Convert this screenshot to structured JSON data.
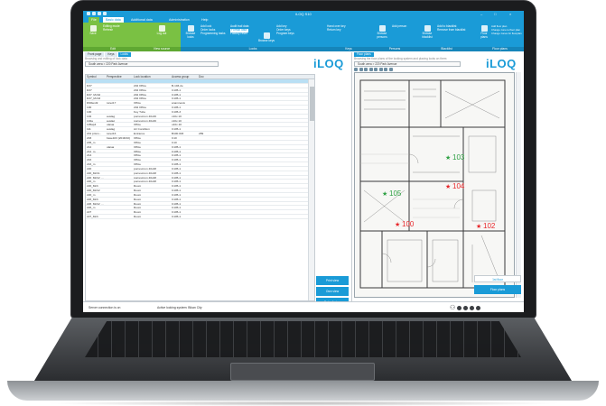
{
  "app": {
    "title": "iLOQ S10",
    "window_controls": [
      "–",
      "□",
      "×"
    ]
  },
  "tabs": [
    {
      "label": "File"
    },
    {
      "label": "Basic data"
    },
    {
      "label": "Additional data"
    },
    {
      "label": "Administration"
    },
    {
      "label": "Help"
    }
  ],
  "ribbon": {
    "groups": [
      {
        "label": "Edit"
      },
      {
        "label": "View source"
      },
      {
        "label": "Locks"
      },
      {
        "label": "Keys"
      },
      {
        "label": "Persons"
      },
      {
        "label": "Blacklist"
      },
      {
        "label": "Floor plans"
      }
    ],
    "edit": {
      "save": "Save",
      "list": [
        "Editing mode",
        "Refresh"
      ]
    },
    "view": {
      "cancel": "Log out"
    },
    "locks": {
      "browse": "Browse locks",
      "list": [
        "Add lock",
        "Order locks",
        "Programming tasks"
      ],
      "list2": [
        "Audit trail data",
        "Format data",
        "Factory reset"
      ]
    },
    "keys": {
      "browse": "Browse keys",
      "list": [
        "Add key",
        "Order keys",
        "Program keys"
      ],
      "list2": [
        "Hand over key",
        "Return key"
      ]
    },
    "persons": {
      "browse": "Browse persons",
      "list": [
        "Add person"
      ]
    },
    "blacklist": {
      "browse": "Browse blacklist",
      "list": [
        "Add to blacklist",
        "Remove from blacklist"
      ]
    },
    "floor": {
      "btn": "Floor plans",
      "list": [
        "Add floor plan",
        "Change zone to floor plan",
        "Change zones for floorplan"
      ]
    }
  },
  "left_panel": {
    "tabs": [
      "Front page",
      "Keys",
      "Locks"
    ],
    "caption": "Browsing and editing of lock data",
    "address": "South area  >  220 Park Avenue",
    "logo": "iLOQ",
    "columns": [
      "Symbol",
      "Perspective",
      "Lock location",
      "Access group",
      "Doc"
    ],
    "rows": [
      [
        "",
        "",
        "",
        "",
        ""
      ],
      [
        "D37",
        "",
        "202 Office",
        "B-103-2e",
        ""
      ],
      [
        "D37",
        "",
        "202 Office",
        "C105-1",
        ""
      ],
      [
        "D37_Mnh2",
        "",
        "202 Office",
        "C105-1",
        ""
      ],
      [
        "D37_Mnh3",
        "",
        "202 Office",
        "C105-1",
        ""
      ],
      [
        "D90test9",
        "tunet17",
        "Office",
        "anamnesis",
        ""
      ],
      [
        "100",
        "",
        "202 Office",
        "C105-1",
        ""
      ],
      [
        "100",
        "",
        "Key Tube",
        "C105-3",
        ""
      ],
      [
        "102",
        "auslag",
        "porrescrum 40x46",
        "c10x.10",
        ""
      ],
      [
        "102a",
        "auslag",
        "porrescrum 40x46",
        "c10x.10",
        ""
      ],
      [
        "105ap4",
        "ulaiua",
        "Office",
        "u10x.10",
        ""
      ],
      [
        "111",
        "auslag",
        "Air Condition",
        "C105-1",
        ""
      ],
      [
        "201 prism...",
        "tunet16",
        "Entrance",
        "B100.003",
        "289"
      ],
      [
        "203",
        "base103 (2018/10)",
        "Office",
        "C10",
        ""
      ],
      [
        "205_m",
        "",
        "Office",
        "C10",
        ""
      ],
      [
        "212",
        "ulaiua",
        "Office",
        "C105-1",
        ""
      ],
      [
        "212_m",
        "",
        "Office",
        "C105-1",
        ""
      ],
      [
        "214",
        "",
        "Office",
        "C105-1",
        ""
      ],
      [
        "216",
        "",
        "Office",
        "C105-1",
        ""
      ],
      [
        "216_m",
        "",
        "Office",
        "C105-1",
        ""
      ],
      [
        "220",
        "",
        "porrescrum 40x48",
        "C105-1",
        ""
      ],
      [
        "220_Mnh1",
        "",
        "porrescrum 40x48",
        "C105-1",
        ""
      ],
      [
        "220_Mnh2_...",
        "",
        "porrescrum 40x48",
        "C105-1",
        ""
      ],
      [
        "220_m",
        "",
        "porrescrum 40x48",
        "C105-1",
        ""
      ],
      [
        "220_Mnh",
        "",
        "Room",
        "C105-1",
        ""
      ],
      [
        "220_Mnh2",
        "",
        "Room",
        "C105-1",
        ""
      ],
      [
        "220_m",
        "",
        "Room",
        "C105-1",
        ""
      ],
      [
        "226_Mnh",
        "",
        "Room",
        "C105-1",
        ""
      ],
      [
        "226_Mnh2_...",
        "",
        "Room",
        "C105-1",
        ""
      ],
      [
        "226_m",
        "",
        "Room",
        "C105-1",
        ""
      ],
      [
        "227",
        "",
        "Room",
        "C105-1",
        ""
      ],
      [
        "227_Mnh",
        "",
        "Room",
        "C105-1",
        ""
      ]
    ],
    "actions": [
      "Print view",
      "Own view",
      "Default view"
    ]
  },
  "right_panel": {
    "tabs": [
      "Floor plans"
    ],
    "caption": "Browsing the floor plans of the locking system and placing locks on them",
    "address": "South area  >  220 Park Avenue",
    "logo": "iLOQ",
    "markers": [
      "103",
      "104",
      "105",
      "100",
      "102"
    ],
    "buttons": [
      "1st floor",
      "Floor plans"
    ]
  },
  "status": {
    "connection": "Server connection is on",
    "system": "Active locking system: Bikan City"
  },
  "colors": {
    "accent": "#1a9bd7",
    "green": "#7ac143",
    "marker_red": "#e8262a",
    "marker_green": "#2ea043"
  }
}
